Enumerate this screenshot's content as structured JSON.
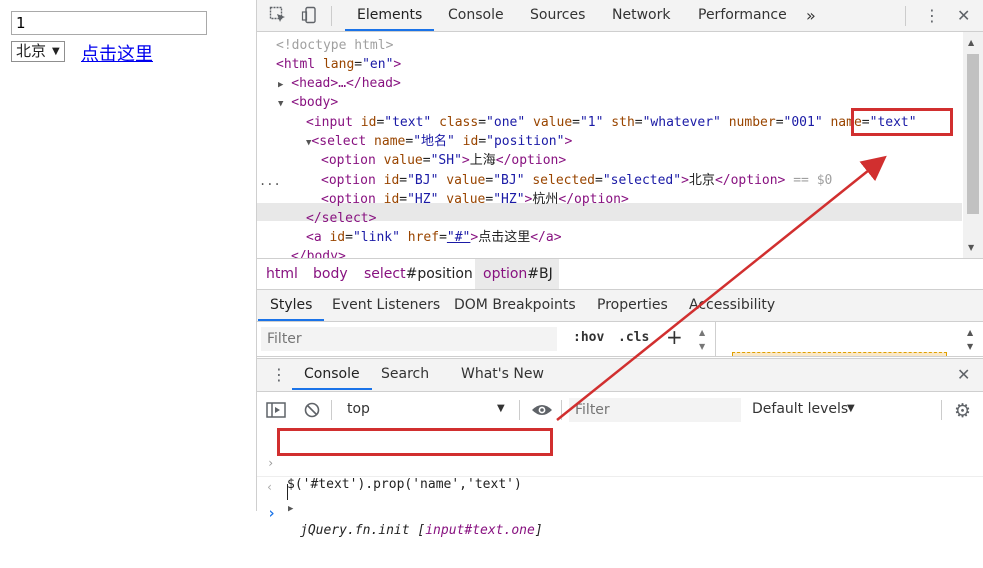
{
  "page": {
    "input_value": "1",
    "select_value": "北京",
    "link_text": "点击这里"
  },
  "devtools": {
    "tabs": [
      "Elements",
      "Console",
      "Sources",
      "Network",
      "Performance"
    ],
    "more_tabs": "»",
    "kebab": "⋮",
    "close": "✕",
    "tree": {
      "doctype": "<!doctype html>",
      "html_tag": "<html",
      "html_lang_attr": " lang",
      "html_lang_val": "\"en\"",
      "html_close": ">",
      "head": "<head>…</head>",
      "body": "<body>",
      "input_open": "<input",
      "input_attrs": [
        {
          "name": " id",
          "value": "\"text\""
        },
        {
          "name": " class",
          "value": "\"one\""
        },
        {
          "name": " value",
          "value": "\"1\""
        },
        {
          "name": " sth",
          "value": "\"whatever\""
        },
        {
          "name": " number",
          "value": "\"001\""
        }
      ],
      "input_name_attr": "name",
      "input_name_val": "\"text\"",
      "select_open": "<select",
      "select_name_attr": " name",
      "select_name_val": "\"地名\"",
      "select_id_attr": " id",
      "select_id_val": "\"position\"",
      "option1_open": "<option",
      "option1_value_attr": " value",
      "option1_value_val": "\"SH\"",
      "option1_text": "上海",
      "option_close": "</option>",
      "option2_open": "<option",
      "option2_id_attr": " id",
      "option2_id_val": "\"BJ\"",
      "option2_value_attr": " value",
      "option2_value_val": "\"BJ\"",
      "option2_selected_attr": " selected",
      "option2_selected_val": "\"selected\"",
      "option2_text": "北京",
      "option2_suffix": " == $0",
      "option3_open": "<option",
      "option3_id_attr": " id",
      "option3_id_val": "\"HZ\"",
      "option3_value_attr": " value",
      "option3_value_val": "\"HZ\"",
      "option3_text": "杭州",
      "select_close": "</select>",
      "a_open": "<a",
      "a_id_attr": " id",
      "a_id_val": "\"link\"",
      "a_href_attr": " href",
      "a_href_val": "\"#\"",
      "a_text": "点击这里",
      "a_close": "</a>",
      "body_close": "</body>",
      "ellipsis": "..."
    },
    "breadcrumbs": [
      {
        "tag": "html",
        "id": ""
      },
      {
        "tag": "body",
        "id": ""
      },
      {
        "tag": "select",
        "id": "#position"
      },
      {
        "tag": "option",
        "id": "#BJ"
      }
    ],
    "styles_tabs": [
      "Styles",
      "Event Listeners",
      "DOM Breakpoints",
      "Properties",
      "Accessibility"
    ],
    "styles_filter_placeholder": "Filter",
    "hov": ":hov",
    "cls": ".cls",
    "plus": "+",
    "drawer_tabs": [
      "Console",
      "Search",
      "What's New"
    ],
    "console": {
      "context": "top",
      "filter_placeholder": "Filter",
      "levels": "Default levels",
      "command": "$('#text').prop('name','text')",
      "result_prefix": "jQuery.fn.init [",
      "result_element": "input#text.one",
      "result_suffix": "]",
      "prompt": "›"
    }
  },
  "colors": {
    "highlight": "#d12f2f",
    "accent": "#1a73e8"
  }
}
